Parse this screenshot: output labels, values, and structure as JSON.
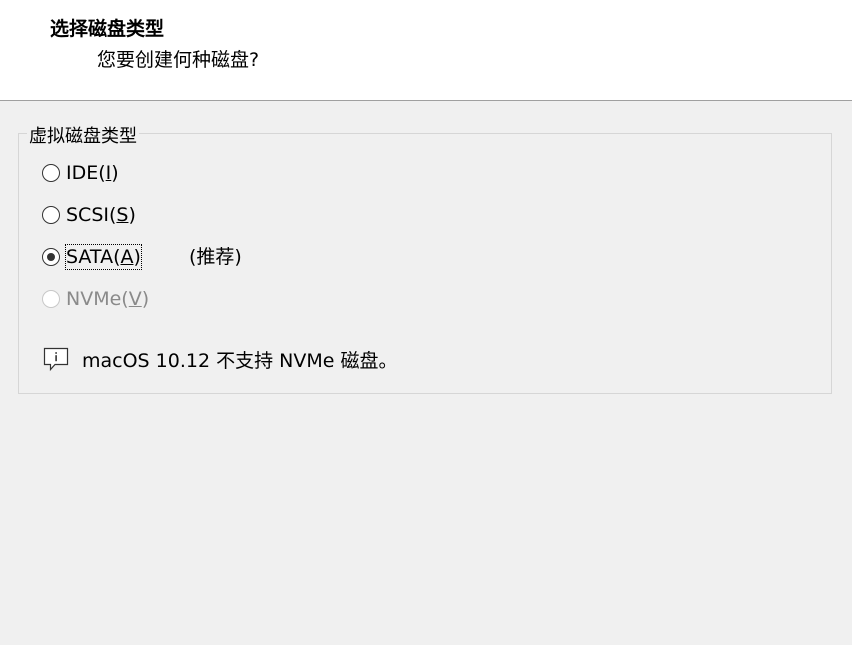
{
  "header": {
    "title": "选择磁盘类型",
    "subtitle": "您要创建何种磁盘?"
  },
  "disk_type_group": {
    "label": "虚拟磁盘类型",
    "options": [
      {
        "prefix": "IDE(",
        "mnemonic": "I",
        "suffix": ")",
        "selected": false,
        "enabled": true
      },
      {
        "prefix": "SCSI(",
        "mnemonic": "S",
        "suffix": ")",
        "selected": false,
        "enabled": true
      },
      {
        "prefix": "SATA(",
        "mnemonic": "A",
        "suffix": ")",
        "selected": true,
        "enabled": true
      },
      {
        "prefix": "NVMe(",
        "mnemonic": "V",
        "suffix": ")",
        "selected": false,
        "enabled": false
      }
    ],
    "recommended_note": "(推荐)"
  },
  "info": {
    "icon": "info-comment-icon",
    "text": "macOS 10.12 不支持 NVMe 磁盘。"
  }
}
